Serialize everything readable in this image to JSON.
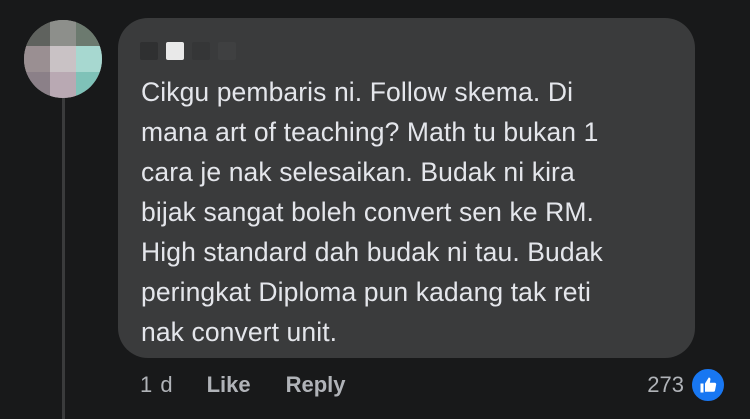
{
  "comment": {
    "text": "Cikgu pembaris ni. Follow skema. Di\nmana art of teaching? Math tu bukan 1\ncara je nak selesaikan. Budak ni kira\nbijak sangat boleh convert sen ke RM.\nHigh standard dah budak ni tau. Budak\nperingkat Diploma pun kadang tak reti\nnak convert unit."
  },
  "actions": {
    "time": "1 d",
    "like_label": "Like",
    "reply_label": "Reply"
  },
  "reactions": {
    "count": "273",
    "icon": "thumbs-up-icon",
    "icon_color": "#1877f2"
  },
  "colors": {
    "background": "#18191a",
    "bubble": "#3a3b3c",
    "text": "#e4e6eb",
    "secondary_text": "#b0b3b8"
  }
}
